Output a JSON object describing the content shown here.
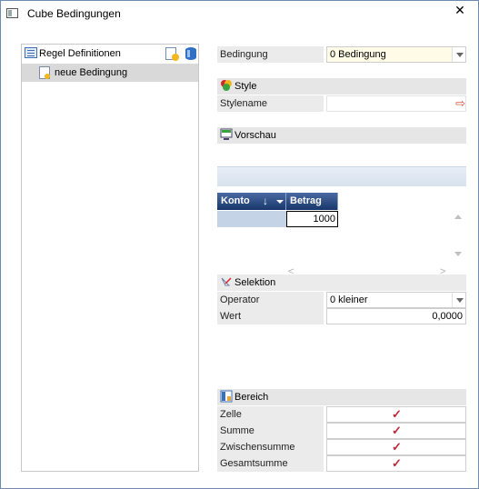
{
  "window": {
    "title": "Cube Bedingungen",
    "close_glyph": "✕"
  },
  "tree": {
    "header_label": "Regel Definitionen",
    "items": [
      {
        "label": "neue Bedingung",
        "selected": true
      }
    ]
  },
  "condition": {
    "label": "Bedingung",
    "value": "0 Bedingung",
    "value_bg": "#fffbe6"
  },
  "style": {
    "section_label": "Style",
    "stylename_label": "Stylename",
    "stylename_value": "",
    "arrow_glyph": "⇨"
  },
  "preview": {
    "section_label": "Vorschau",
    "grid": {
      "columns": [
        "Konto",
        "Betrag"
      ],
      "sort_glyph": "↓",
      "rows": [
        {
          "konto": "",
          "betrag": "1000"
        }
      ]
    },
    "scroll_left": "<",
    "scroll_right": ">"
  },
  "selection": {
    "section_label": "Selektion",
    "operator_label": "Operator",
    "operator_value": "0 kleiner",
    "wert_label": "Wert",
    "wert_value": "0,0000"
  },
  "range": {
    "section_label": "Bereich",
    "check_glyph": "✓",
    "items": [
      {
        "label": "Zelle",
        "checked": true
      },
      {
        "label": "Summe",
        "checked": true
      },
      {
        "label": "Zwischensumme",
        "checked": true
      },
      {
        "label": "Gesamtsumme",
        "checked": true
      }
    ]
  },
  "colors": {
    "accent": "#17366b",
    "check": "#c0283a",
    "label_bg": "#ebebeb"
  }
}
